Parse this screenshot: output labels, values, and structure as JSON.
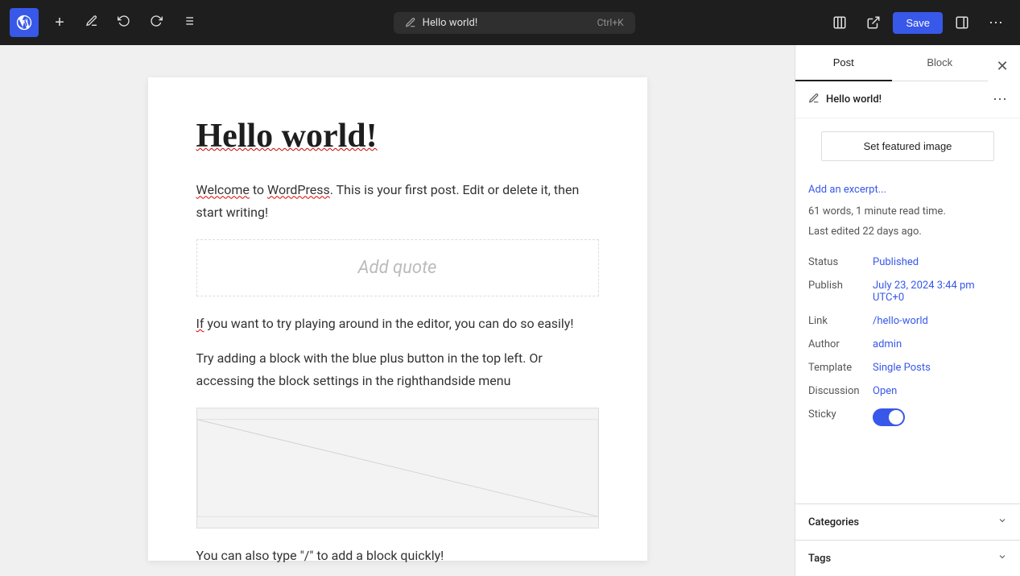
{
  "toolbar": {
    "wp_logo": "W",
    "add_label": "+",
    "undo_label": "↩",
    "redo_label": "↪",
    "list_view_label": "≡",
    "document_title": "Hello world!",
    "shortcut": "Ctrl+K",
    "view_label": "⬜",
    "external_label": "⬚",
    "save_label": "Save",
    "layout_label": "▦",
    "more_label": "⋯"
  },
  "editor": {
    "post_title": "Hello world!",
    "paragraphs": [
      "Welcome to WordPress. This is your first post. Edit or delete it, then start writing!",
      "If you want to try playing around in the editor, you can do so easily!",
      "Try adding a block with the blue plus button in the top left. Or accessing the block settings in the righthandside menu",
      "You can also type \"/\" to add a block quickly!"
    ],
    "add_quote_placeholder": "Add quote"
  },
  "sidebar": {
    "tab_post": "Post",
    "tab_block": "Block",
    "close_label": "✕",
    "post_icon": "✏️",
    "post_name": "Hello world!",
    "more_options_label": "⋯",
    "featured_image_btn": "Set featured image",
    "excerpt_link": "Add an excerpt...",
    "meta_info": "61 words, 1 minute read time.",
    "last_edited": "Last edited 22 days ago.",
    "status_label": "Status",
    "status_value": "Published",
    "publish_label": "Publish",
    "publish_value": "July 23, 2024 3:44 pm UTC+0",
    "link_label": "Link",
    "link_value": "/hello-world",
    "author_label": "Author",
    "author_value": "admin",
    "template_label": "Template",
    "template_value": "Single Posts",
    "discussion_label": "Discussion",
    "discussion_value": "Open",
    "sticky_label": "Sticky",
    "categories_label": "Categories",
    "tags_label": "Tags"
  }
}
